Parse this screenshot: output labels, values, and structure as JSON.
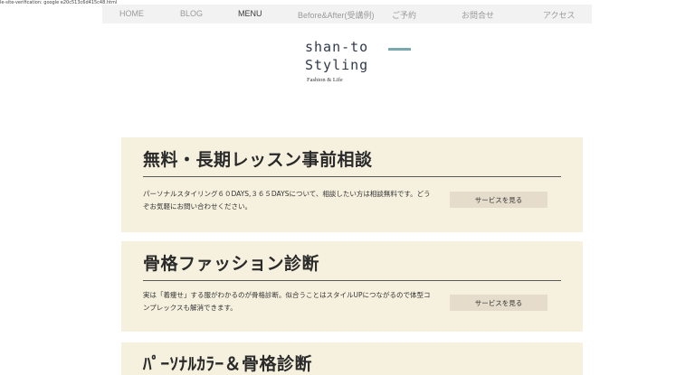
{
  "verification_text": "le-site-verification: google e20c513c6d415c48.html",
  "nav": {
    "items": [
      {
        "label": "HOME"
      },
      {
        "label": "BLOG"
      },
      {
        "label": "MENU"
      },
      {
        "label": "Before&After(受講例)"
      },
      {
        "label": "ご予約"
      },
      {
        "label": "お問合せ"
      },
      {
        "label": "アクセス"
      }
    ],
    "active_item": "MENU"
  },
  "logo": {
    "line1": "shan-to",
    "line2": "Styling",
    "tagline": "Fashion & Life",
    "accent_color": "#79a9ad"
  },
  "cards": [
    {
      "title": "無料・長期レッスン事前相談",
      "description": "パーソナルスタイリング６０DAYS,３６５DAYSについて、相談したい方は相談無料です。どうぞお気軽にお問い合わせください。",
      "button_label": "サービスを見る"
    },
    {
      "title": "骨格ファッション診断",
      "description": "実は「着痩せ」する服がわかるのが骨格診断。似合うことはスタイルUPにつながるので体型コンプレックスも解消できます。",
      "button_label": "サービスを見る"
    },
    {
      "title": "ﾊﾟｰｿﾅﾙｶﾗｰ＆骨格診断"
    }
  ],
  "colors": {
    "card_background": "#f6f1de",
    "button_background": "#e6dccb",
    "nav_background": "#f2f2f2"
  }
}
